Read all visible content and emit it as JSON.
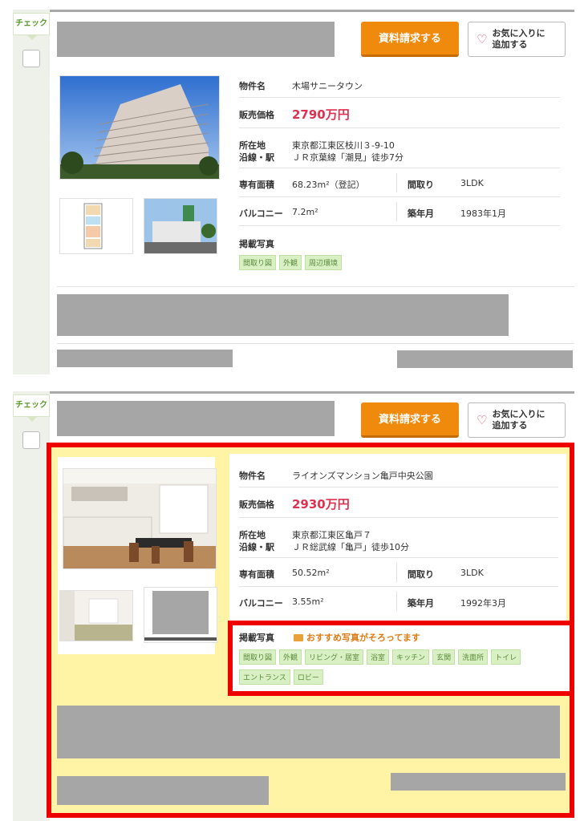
{
  "common": {
    "check_label": "チェック",
    "request_button": "資料請求する",
    "favorite_line1": "お気に入りに",
    "favorite_line2": "追加する"
  },
  "labels": {
    "name": "物件名",
    "price": "販売価格",
    "address": "所在地",
    "line_station": "沿線・駅",
    "area": "専有面積",
    "layout": "間取り",
    "balcony": "バルコニー",
    "built": "築年月",
    "photos": "掲載写真"
  },
  "listings": [
    {
      "name": "木場サニータウン",
      "price": "2790万円",
      "address": "東京都江東区枝川３-9-10",
      "station": "ＪＲ京葉線「潮見」徒歩7分",
      "area": "68.23m²（登記）",
      "layout": "3LDK",
      "balcony": "7.2m²",
      "built": "1983年1月",
      "photo_tags": [
        "間取り図",
        "外観",
        "周辺環境"
      ]
    },
    {
      "name": "ライオンズマンション亀戸中央公園",
      "price": "2930万円",
      "address": "東京都江東区亀戸７",
      "station": "ＪＲ総武線「亀戸」徒歩10分",
      "area": "50.52m²",
      "layout": "3LDK",
      "balcony": "3.55m²",
      "built": "1992年3月",
      "recommend_text": "おすすめ写真がそろってます",
      "photo_tags": [
        "間取り図",
        "外観",
        "リビング・居室",
        "浴室",
        "キッチン",
        "玄関",
        "洗面所",
        "トイレ",
        "エントランス",
        "ロビー"
      ]
    }
  ],
  "colors": {
    "accent_orange": "#f08a0c",
    "price_red": "#e0304f",
    "highlight_red": "#ee0000",
    "highlight_yellow": "#fff3a6"
  }
}
